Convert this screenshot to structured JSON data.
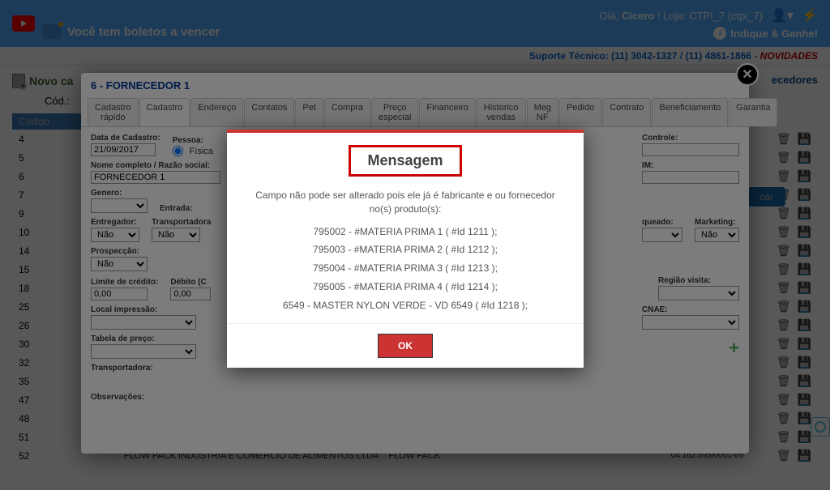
{
  "topbar": {
    "boletos": "Você tem boletos a vencer",
    "greeting_prefix": "Olá, ",
    "user": "Cicero",
    "greeting_suffix": " ! Loja: CTPI_7 (ctpi_7)",
    "indique": "Indique & Ganhe!"
  },
  "suporte": {
    "label": "Suporte Técnico: ",
    "tel1": "(11) 3042-1327",
    "sep": " / ",
    "tel2": "(11) 4861-1866",
    "dash": " - ",
    "novidades": "NOVIDADES"
  },
  "page": {
    "novo": "Novo ca",
    "forn_title": "ecedores",
    "cod": "Cód.:",
    "buscar": "car",
    "header_codigo": "Código"
  },
  "codes": [
    "4",
    "5",
    "6",
    "7",
    "9",
    "10",
    "14",
    "15",
    "18",
    "25",
    "26",
    "30",
    "32",
    "35",
    "47",
    "48",
    "51",
    "52"
  ],
  "last_row": {
    "text": "FLOW PACK INDUSTRIA E COMERCIO DE ALIMENTOS LTDA",
    "text2": "FLOW PACK",
    "cnpj": "04.162.695/0001-69"
  },
  "modal": {
    "title": "6 - FORNECEDOR 1",
    "tabs": [
      "Cadastro rápido",
      "Cadastro",
      "Endereço",
      "Contatos",
      "Pet",
      "Compra",
      "Preço especial",
      "Financeiro",
      "Historico vendas",
      "Meg NF",
      "Pedido",
      "Contrato",
      "Beneficiamento",
      "Garantia"
    ],
    "form": {
      "data_cadastro_lbl": "Data de Cadastro:",
      "data_cadastro": "21/09/2017",
      "pessoa_lbl": "Pessoa:",
      "pessoa_fisica": "Física",
      "controle_lbl": "Controle:",
      "nome_lbl": "Nome completo / Razão social:",
      "nome": "FORNECEDOR 1",
      "im_lbl": "IM:",
      "genero_lbl": "Genero:",
      "entrada_lbl": "Entrada:",
      "entregador_lbl": "Entregador:",
      "nao": "Não",
      "transportadora_lbl": "Transportadora",
      "queado_lbl": "queado:",
      "marketing_lbl": "Marketing:",
      "prospeccao_lbl": "Prospecção:",
      "limite_lbl": "Limite de crédito:",
      "zero": "0,00",
      "debito_lbl": "Débito (C",
      "regiao_lbl": "Região visita:",
      "local_lbl": "Local impressão:",
      "cnae_lbl": "CNAE:",
      "tabela_lbl": "Tabela de preço:",
      "transp_lbl": "Transportadora:",
      "obs_lbl": "Observações:"
    }
  },
  "msg": {
    "title": "Mensagem",
    "intro": "Campo não pode ser alterado pois ele já é fabricante e ou fornecedor no(s) produto(s):",
    "items": [
      "795002 - #MATERIA PRIMA 1 ( #Id 1211 );",
      "795003 - #MATERIA PRIMA 2 ( #Id 1212 );",
      "795004 - #MATERIA PRIMA 3 ( #Id 1213 );",
      "795005 - #MATERIA PRIMA 4 ( #Id 1214 );",
      "6549 - MASTER NYLON VERDE - VD 6549 ( #Id 1218 );"
    ],
    "ok": "OK"
  }
}
